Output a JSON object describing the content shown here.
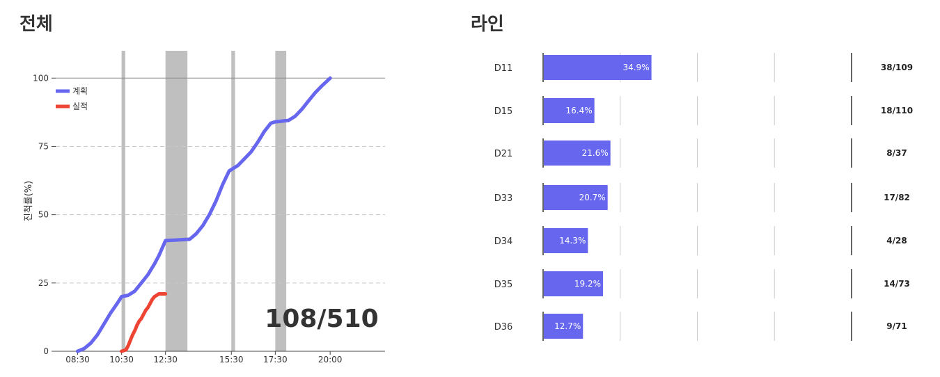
{
  "left_title": "전체",
  "right_title": "라인",
  "overall_total": "108/510",
  "colors": {
    "plan": "#6666ee",
    "actual": "#ee4433",
    "band": "#bfbfbf"
  },
  "chart_data": [
    {
      "type": "line",
      "ylabel": "진척률(%)",
      "ylim": [
        0,
        110
      ],
      "yticks": [
        0,
        25,
        50,
        75,
        100
      ],
      "xlim": [
        "07:30",
        "22:30"
      ],
      "xticks": [
        "08:30",
        "10:30",
        "12:30",
        "15:30",
        "17:30",
        "20:00"
      ],
      "legend_position": "top-left",
      "bands": [
        [
          "10:30",
          "10:40"
        ],
        [
          "12:30",
          "13:30"
        ],
        [
          "15:30",
          "15:40"
        ],
        [
          "17:30",
          "18:00"
        ]
      ],
      "series": [
        {
          "name": "계획",
          "x": [
            "08:30",
            "08:48",
            "09:06",
            "09:24",
            "09:42",
            "10:00",
            "10:18",
            "10:30",
            "10:48",
            "11:06",
            "11:24",
            "11:42",
            "12:00",
            "12:12",
            "12:30",
            "13:36",
            "13:54",
            "14:12",
            "14:30",
            "14:48",
            "15:06",
            "15:24",
            "15:30",
            "15:48",
            "16:06",
            "16:24",
            "16:42",
            "17:00",
            "17:18",
            "17:30",
            "18:06",
            "18:24",
            "18:42",
            "19:00",
            "19:18",
            "19:36",
            "20:00"
          ],
          "values": [
            0,
            1,
            3,
            6,
            10,
            14,
            17.5,
            20,
            20.5,
            22,
            25,
            28,
            32,
            35,
            40.5,
            41,
            43,
            46,
            50,
            55,
            61,
            66,
            66.5,
            68,
            70.5,
            73,
            76.5,
            80.5,
            83.5,
            84,
            84.5,
            86,
            88.5,
            91.5,
            94.5,
            97,
            100
          ]
        },
        {
          "name": "실적",
          "x": [
            "10:30",
            "10:42",
            "10:48",
            "10:54",
            "11:00",
            "11:06",
            "11:12",
            "11:18",
            "11:24",
            "11:30",
            "11:36",
            "11:42",
            "11:48",
            "11:54",
            "12:00",
            "12:06",
            "12:12",
            "12:18",
            "12:24",
            "12:30"
          ],
          "values": [
            0,
            0.5,
            2,
            4,
            6,
            7.5,
            9.5,
            11,
            12,
            13.5,
            15,
            16,
            17.5,
            19,
            20,
            20.5,
            21,
            21,
            21,
            21
          ]
        }
      ]
    },
    {
      "type": "bar",
      "orientation": "horizontal",
      "xlim": [
        0,
        100
      ],
      "categories": [
        "D11",
        "D15",
        "D21",
        "D33",
        "D34",
        "D35",
        "D36"
      ],
      "values": [
        34.9,
        16.4,
        21.6,
        20.7,
        14.3,
        19.2,
        12.7
      ],
      "labels": [
        "34.9%",
        "16.4%",
        "21.6%",
        "20.7%",
        "14.3%",
        "19.2%",
        "12.7%"
      ],
      "ratios": [
        "38/109",
        "18/110",
        "8/37",
        "17/82",
        "4/28",
        "14/73",
        "9/71"
      ]
    }
  ]
}
